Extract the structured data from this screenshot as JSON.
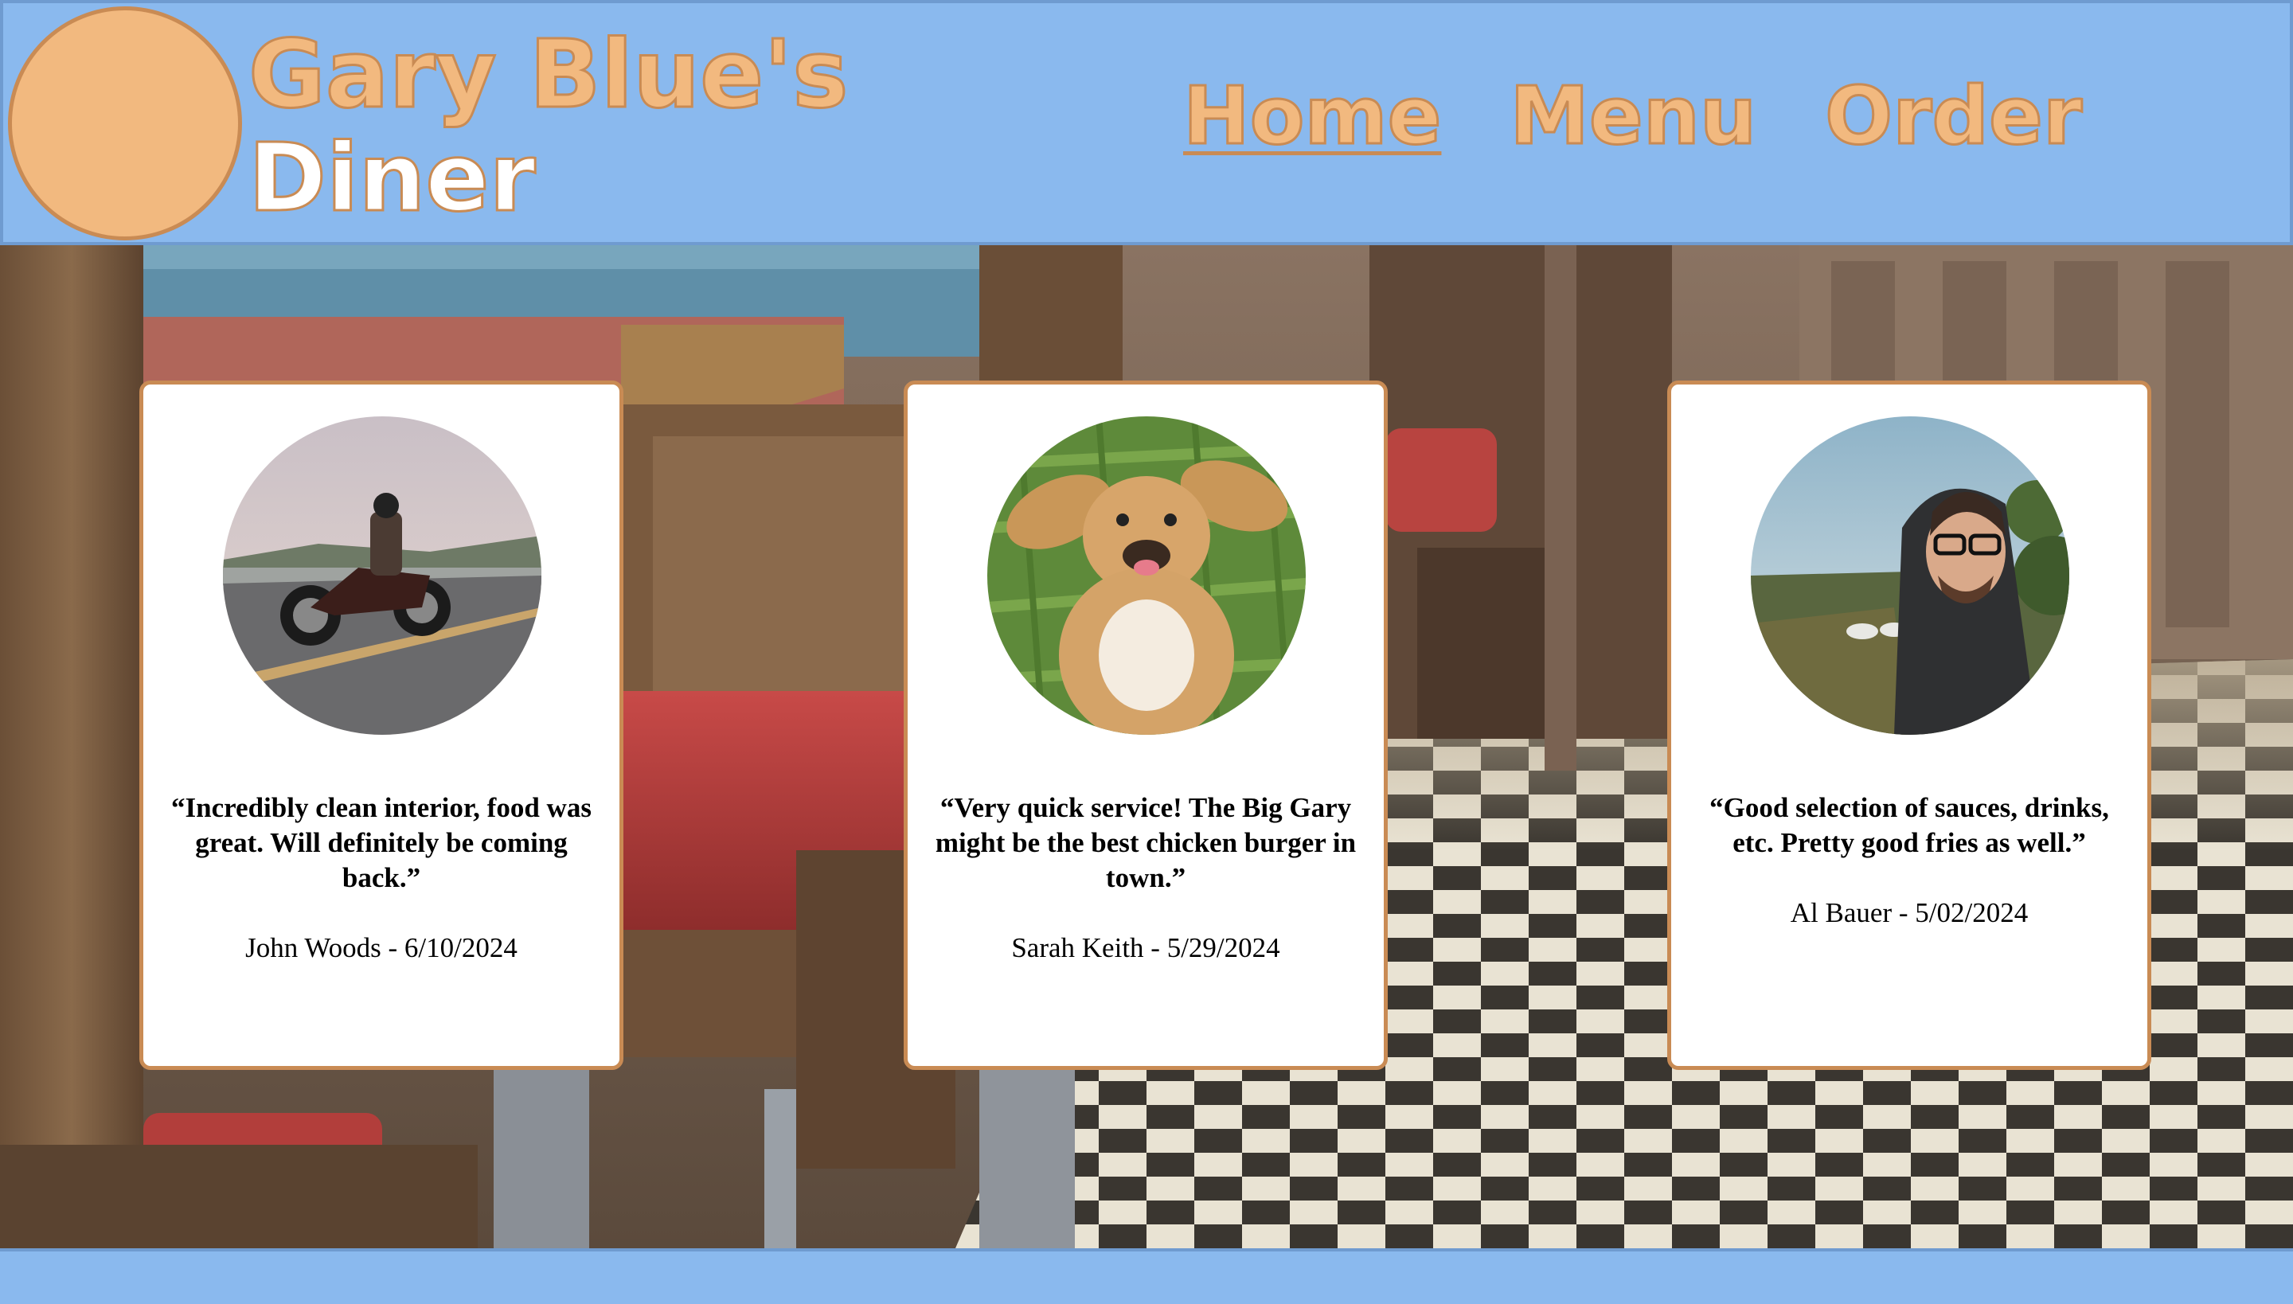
{
  "brand": {
    "line1": "Gary Blue's",
    "line2": "Diner"
  },
  "nav": {
    "items": [
      {
        "label": "Home",
        "active": true
      },
      {
        "label": "Menu",
        "active": false
      },
      {
        "label": "Order",
        "active": false
      }
    ]
  },
  "colors": {
    "header_blue": "#8ab9ee",
    "accent_orange": "#f2b97f",
    "accent_border": "#c98b54"
  },
  "reviews": [
    {
      "photo": "motorcycle-rider-photo",
      "quote": "“Incredibly clean interior, food was great. Will definitely be coming back.”",
      "author": "John Woods - 6/10/2024"
    },
    {
      "photo": "dog-in-grass-photo",
      "quote": "“Very quick service! The Big Gary might be the best chicken burger in town.”",
      "author": "Sarah Keith - 5/29/2024"
    },
    {
      "photo": "man-in-hoodie-photo",
      "quote": "“Good selection of sauces, drinks, etc. Pretty good fries as well.”",
      "author": "Al Bauer - 5/02/2024"
    }
  ]
}
